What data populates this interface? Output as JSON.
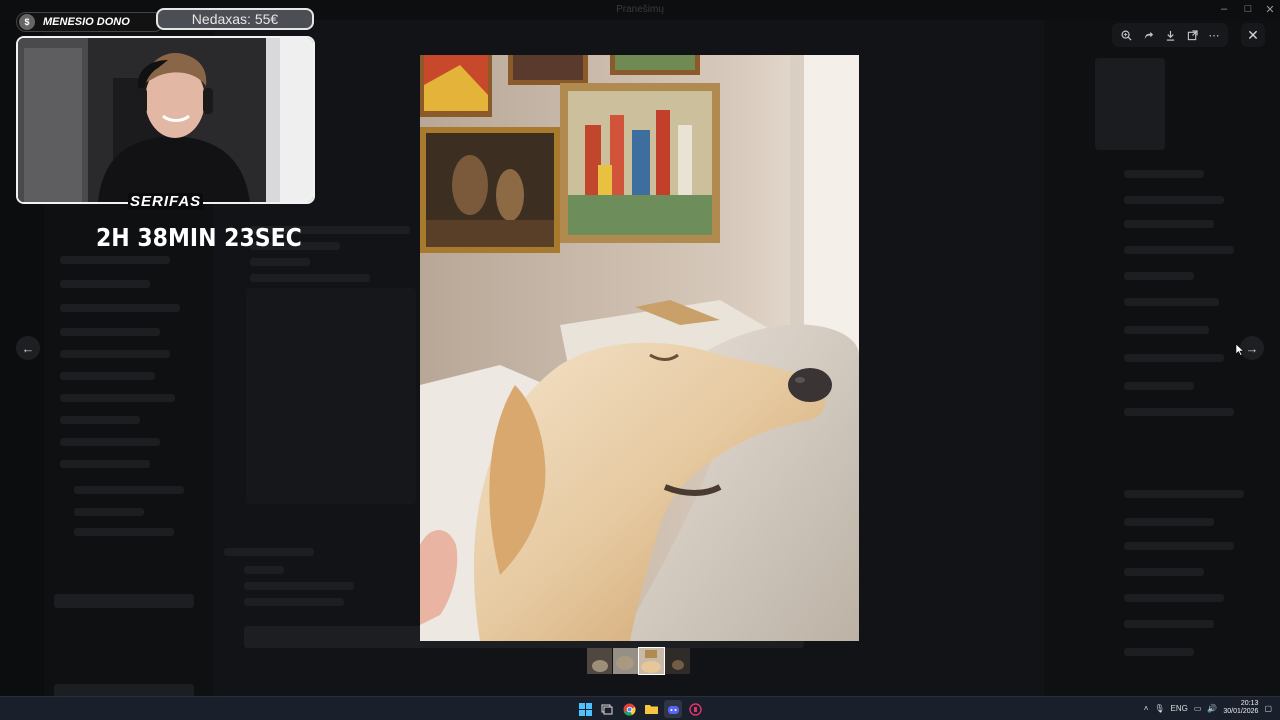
{
  "window": {
    "title": "Pranešimų"
  },
  "overlay_toolbar": {
    "icons": [
      "zoom-icon",
      "forward-icon",
      "download-icon",
      "open-external-icon",
      "more-icon"
    ]
  },
  "stream_overlay": {
    "donor_label": "MENESIO DONO",
    "goal_label": "Nedaxas: 55€",
    "streamer_name": "SERIFAS",
    "timer": "2H 38MIN 23SEC"
  },
  "gallery": {
    "thumbnail_count": 4,
    "active_thumbnail_index": 2
  },
  "taskbar": {
    "language": "ENG",
    "time": "20:13",
    "date": "30/01/2026"
  },
  "colors": {
    "overlay_bg": "#0b0b0d",
    "taskbar_bg": "#1a1f2c"
  }
}
